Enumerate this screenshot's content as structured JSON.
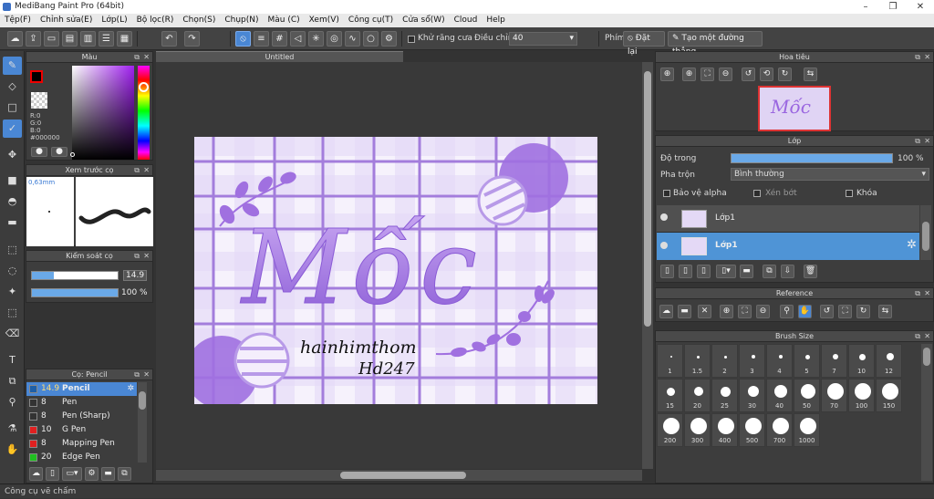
{
  "window": {
    "title": "MediBang Paint Pro (64bit)",
    "min": "–",
    "max": "❐",
    "close": "✕"
  },
  "menu": [
    "Tệp(F)",
    "Chỉnh sửa(E)",
    "Lớp(L)",
    "Bộ lọc(R)",
    "Chọn(S)",
    "Chụp(N)",
    "Màu (C)",
    "Xem(V)",
    "Công cụ(T)",
    "Cửa sổ(W)",
    "Cloud",
    "Help"
  ],
  "toolbar": {
    "antialias_label": "Khử răng cưa",
    "adjust_label": "Điều chỉnh",
    "adjust_value": "40",
    "key_label": "Phím",
    "reset_label": "Đặt lại",
    "straight_label": "Tạo một đường thẳng"
  },
  "color_panel": {
    "title": "Màu",
    "r": "R:0",
    "g": "G:0",
    "b": "B:0",
    "hex": "#000000"
  },
  "preview_panel": {
    "title": "Xem trước cọ",
    "size": "0,63mm"
  },
  "control_panel": {
    "title": "Kiểm soát cọ",
    "size_value": "14.9",
    "opacity_value": "100 %",
    "size_fill": 0.25,
    "opacity_fill": 1.0
  },
  "brush_list": {
    "title": "Cọ: Pencil",
    "items": [
      {
        "size": "14.9",
        "name": "Pencil",
        "color": "#1e5fa8",
        "selected": true
      },
      {
        "size": "8",
        "name": "Pen",
        "color": "#333333"
      },
      {
        "size": "8",
        "name": "Pen (Sharp)",
        "color": "#333333"
      },
      {
        "size": "10",
        "name": "G Pen",
        "color": "#e02020"
      },
      {
        "size": "8",
        "name": "Mapping Pen",
        "color": "#e02020"
      },
      {
        "size": "20",
        "name": "Edge Pen",
        "color": "#20c020"
      }
    ]
  },
  "document": {
    "tab": "Untitled",
    "title_art": "Mốc",
    "signature_1": "hainhimthom",
    "signature_2": "Hd247"
  },
  "navigator": {
    "title": "Hoa tiêu"
  },
  "layer_panel": {
    "title": "Lớp",
    "opacity_label": "Độ trong",
    "opacity_value": "100 %",
    "blend_label": "Pha trộn",
    "blend_value": "Bình thường",
    "protect_alpha": "Bảo vệ alpha",
    "clipping": "Xén bớt",
    "lock": "Khóa",
    "layers": [
      {
        "name": "Lớp1",
        "selected": false
      },
      {
        "name": "Lớp1",
        "selected": true
      }
    ]
  },
  "reference_panel": {
    "title": "Reference"
  },
  "brush_size_panel": {
    "title": "Brush Size",
    "sizes": [
      "1",
      "1.5",
      "2",
      "3",
      "4",
      "5",
      "7",
      "10",
      "12",
      "15",
      "20",
      "25",
      "30",
      "40",
      "50",
      "70",
      "100",
      "150",
      "200",
      "300",
      "400",
      "500",
      "700",
      "1000"
    ]
  },
  "status": {
    "text": "Công cụ vẽ chấm"
  },
  "colors": {
    "accent": "#4a87d4",
    "paper": "#f1ecfa",
    "grid": "#9b77d6",
    "lettering": "#a070e0"
  }
}
